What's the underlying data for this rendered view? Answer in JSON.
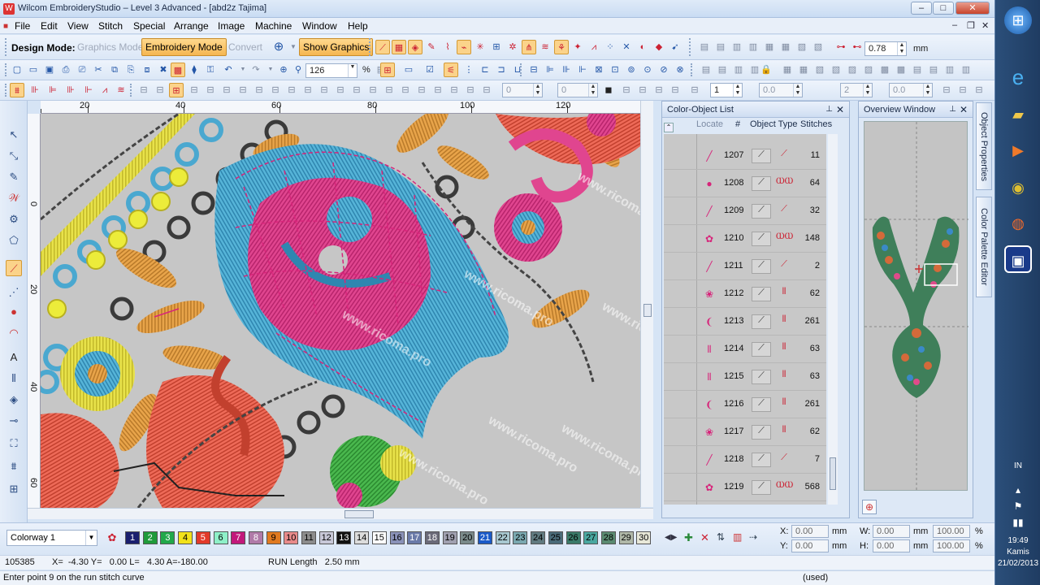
{
  "window": {
    "title": "Wilcom EmbroideryStudio – Level 3 Advanced - [abd2z          Tajima]",
    "min_btn": "–",
    "max_btn": "□",
    "close_btn": "✕"
  },
  "menu": {
    "items": [
      "File",
      "Edit",
      "View",
      "Stitch",
      "Special",
      "Arrange",
      "Image",
      "Machine",
      "Window",
      "Help"
    ],
    "mdi_min": "–",
    "mdi_restore": "❐",
    "mdi_close": "✕"
  },
  "toolbar1": {
    "design_mode_label": "Design Mode:",
    "graphics_mode": "Graphics Mode",
    "embroidery_mode": "Embroidery Mode",
    "convert": "Convert",
    "show_graphics": "Show Graphics",
    "spacing_value": "0.78",
    "spacing_unit": "mm"
  },
  "toolbar2": {
    "zoom_value": "126",
    "zoom_unit": "%"
  },
  "toolbar3": {
    "field_a": "0",
    "field_b": "0",
    "field_c": "1",
    "field_d": "0.0",
    "field_e": "2",
    "field_f": "0.0"
  },
  "ruler": {
    "top_labels": [
      "20",
      "40",
      "60",
      "80",
      "100",
      "120"
    ],
    "left_labels": [
      "0",
      "20",
      "40",
      "60"
    ]
  },
  "canvas": {
    "watermark": "www.ricoma.pro"
  },
  "color_object_list": {
    "title": "Color-Object List",
    "pin": "📌",
    "close": "✕",
    "header_locate": "Locate",
    "header_num": "#",
    "header_type": "Object Type",
    "header_stitches": "Stitches",
    "rows": [
      {
        "num": "1207",
        "stitches": "11",
        "swatch": "╱",
        "color": "#d7247a",
        "type2": "⟋"
      },
      {
        "num": "1208",
        "stitches": "64",
        "swatch": "●",
        "color": "#d7247a",
        "type2": "ⲰⲰ"
      },
      {
        "num": "1209",
        "stitches": "32",
        "swatch": "╱",
        "color": "#d7247a",
        "type2": "⟋"
      },
      {
        "num": "1210",
        "stitches": "148",
        "swatch": "✿",
        "color": "#d7247a",
        "type2": "ⲰⲰ"
      },
      {
        "num": "1211",
        "stitches": "2",
        "swatch": "╱",
        "color": "#d7247a",
        "type2": "⟋"
      },
      {
        "num": "1212",
        "stitches": "62",
        "swatch": "❀",
        "color": "#d7247a",
        "type2": "⦀"
      },
      {
        "num": "1213",
        "stitches": "261",
        "swatch": "❨",
        "color": "#d7247a",
        "type2": "⦀"
      },
      {
        "num": "1214",
        "stitches": "63",
        "swatch": "⦀",
        "color": "#d7247a",
        "type2": "⦀"
      },
      {
        "num": "1215",
        "stitches": "63",
        "swatch": "⦀",
        "color": "#d7247a",
        "type2": "⦀"
      },
      {
        "num": "1216",
        "stitches": "261",
        "swatch": "❨",
        "color": "#d7247a",
        "type2": "⦀"
      },
      {
        "num": "1217",
        "stitches": "62",
        "swatch": "❀",
        "color": "#d7247a",
        "type2": "⦀"
      },
      {
        "num": "1218",
        "stitches": "7",
        "swatch": "╱",
        "color": "#d7247a",
        "type2": "⟋"
      },
      {
        "num": "1219",
        "stitches": "568",
        "swatch": "✿",
        "color": "#d7247a",
        "type2": "ⲰⲰ"
      }
    ]
  },
  "overview": {
    "title": "Overview Window",
    "pin": "📌",
    "close": "✕"
  },
  "side_tabs": {
    "object_properties": "Object Properties",
    "color_palette_editor": "Color Palette Editor"
  },
  "palette": {
    "colorway": "Colorway 1",
    "swatches": [
      {
        "n": "1",
        "bg": "#1a1f6e",
        "fg": "#ffffff"
      },
      {
        "n": "2",
        "bg": "#1f9a3a",
        "fg": "#ffffff"
      },
      {
        "n": "3",
        "bg": "#21a84a",
        "fg": "#ffffff"
      },
      {
        "n": "4",
        "bg": "#f2e21a",
        "fg": "#000000"
      },
      {
        "n": "5",
        "bg": "#e23a2a",
        "fg": "#ffffff"
      },
      {
        "n": "6",
        "bg": "#8ef0c8",
        "fg": "#000000"
      },
      {
        "n": "7",
        "bg": "#c2187a",
        "fg": "#ffffff"
      },
      {
        "n": "8",
        "bg": "#b07aa8",
        "fg": "#ffffff"
      },
      {
        "n": "9",
        "bg": "#e07a20",
        "fg": "#000000"
      },
      {
        "n": "10",
        "bg": "#e88a8a",
        "fg": "#000000"
      },
      {
        "n": "11",
        "bg": "#8c8c8c",
        "fg": "#000000"
      },
      {
        "n": "12",
        "bg": "#c8c8d8",
        "fg": "#000000"
      },
      {
        "n": "13",
        "bg": "#111111",
        "fg": "#ffffff"
      },
      {
        "n": "14",
        "bg": "#dcdcdc",
        "fg": "#000000"
      },
      {
        "n": "15",
        "bg": "#ffffff",
        "fg": "#000000"
      },
      {
        "n": "16",
        "bg": "#8a92b8",
        "fg": "#000000"
      },
      {
        "n": "17",
        "bg": "#6a7aa8",
        "fg": "#ffffff"
      },
      {
        "n": "18",
        "bg": "#6a6a78",
        "fg": "#ffffff"
      },
      {
        "n": "19",
        "bg": "#a0a0b0",
        "fg": "#000000"
      },
      {
        "n": "20",
        "bg": "#7a8a8a",
        "fg": "#000000"
      },
      {
        "n": "21",
        "bg": "#1a5ac8",
        "fg": "#ffffff"
      },
      {
        "n": "22",
        "bg": "#a8c8d0",
        "fg": "#000000"
      },
      {
        "n": "23",
        "bg": "#7aa8b0",
        "fg": "#000000"
      },
      {
        "n": "24",
        "bg": "#607a80",
        "fg": "#000000"
      },
      {
        "n": "25",
        "bg": "#4a6a78",
        "fg": "#000000"
      },
      {
        "n": "26",
        "bg": "#3a7a68",
        "fg": "#000000"
      },
      {
        "n": "27",
        "bg": "#4aa8a0",
        "fg": "#000000"
      },
      {
        "n": "28",
        "bg": "#5a8a70",
        "fg": "#000000"
      },
      {
        "n": "29",
        "bg": "#b0b8a8",
        "fg": "#000000"
      },
      {
        "n": "30",
        "bg": "#e8e8d8",
        "fg": "#000000"
      }
    ]
  },
  "coords": {
    "x_label": "X:",
    "x_value": "0.00",
    "y_label": "Y:",
    "y_value": "0.00",
    "w_label": "W:",
    "w_value": "0.00",
    "h_label": "H:",
    "h_value": "0.00",
    "unit": "mm",
    "wp_value": "100.00",
    "hp_value": "100.00",
    "pct": "%"
  },
  "status": {
    "stitch_count": "105385",
    "position": "X=  -4.30 Y=   0.00 L=   4.30 A=-180.00",
    "run_length": "RUN Length   2.50 mm",
    "prompt": "Enter point 9 on the run stitch curve",
    "used": "(used)"
  },
  "taskbar": {
    "lang": "IN",
    "time": "19:49",
    "day": "Kamis",
    "date": "21/02/2013"
  }
}
